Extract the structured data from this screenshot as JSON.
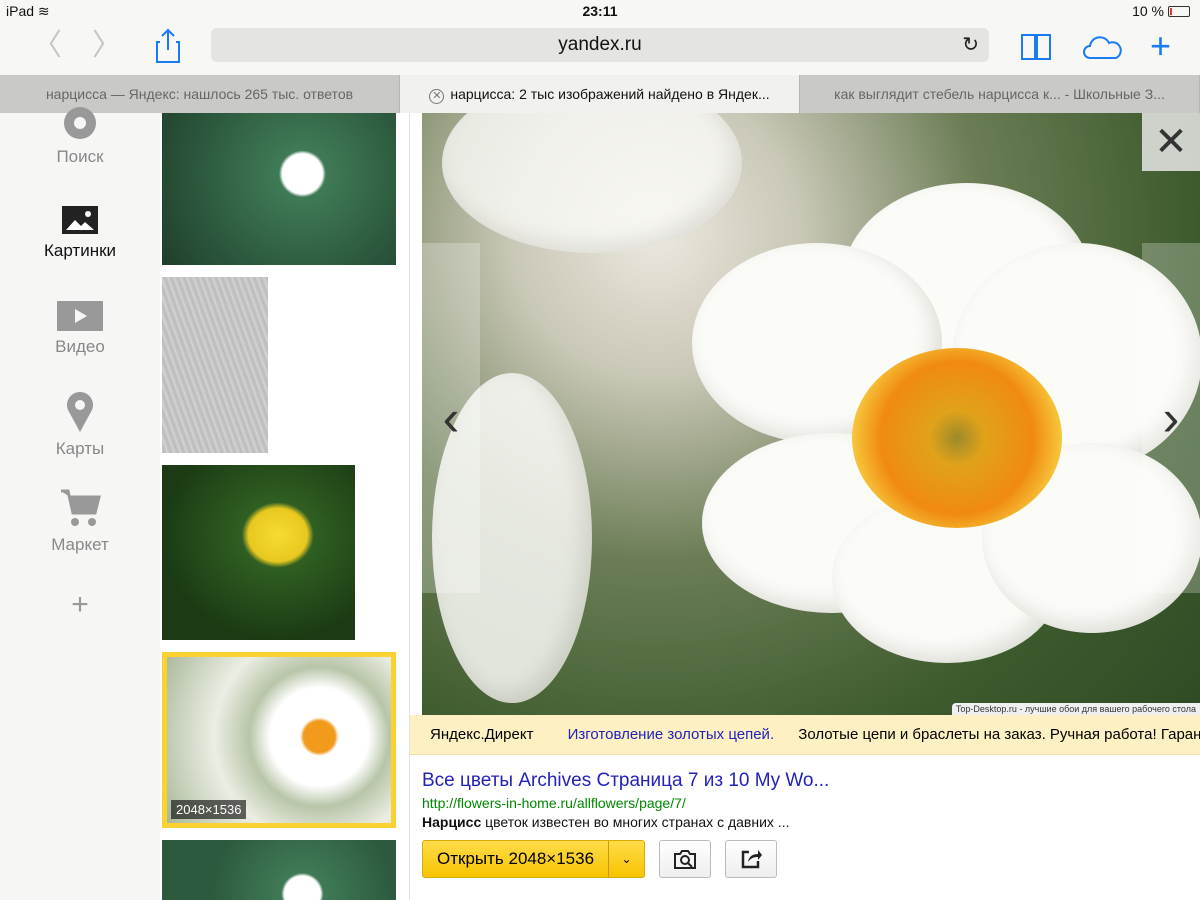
{
  "status": {
    "device": "iPad",
    "time": "23:11",
    "battery": "10 %"
  },
  "toolbar": {
    "url": "yandex.ru"
  },
  "tabs": [
    {
      "label": "нарцисса — Яндекс: нашлось 265 тыс. ответов"
    },
    {
      "label": "нарцисса: 2 тыс изображений найдено в Яндек..."
    },
    {
      "label": "как выглядит стебель нарцисса к... - Школьные З..."
    }
  ],
  "sidebar": {
    "items": [
      {
        "label": "Поиск"
      },
      {
        "label": "Картинки"
      },
      {
        "label": "Видео"
      },
      {
        "label": "Карты"
      },
      {
        "label": "Маркет"
      }
    ],
    "add": "+"
  },
  "thumbs": {
    "selected_size": "2048×1536"
  },
  "viewer": {
    "credit": "Top-Desktop.ru - лучшие обои для вашего рабочего стола"
  },
  "ad": {
    "source": "Яндекс.Директ",
    "link": "Изготовление золотых цепей.",
    "text": "Золотые цепи и браслеты на заказ. Ручная работа! Гарантия"
  },
  "result": {
    "title": "Все цветы Archives Страница 7 из 10 My Wo...",
    "url": "http://flowers-in-home.ru/allflowers/page/7/",
    "desc_bold": "Нарцисс",
    "desc": " цветок известен во многих странах с давних ...",
    "open": "Открыть 2048×1536"
  }
}
